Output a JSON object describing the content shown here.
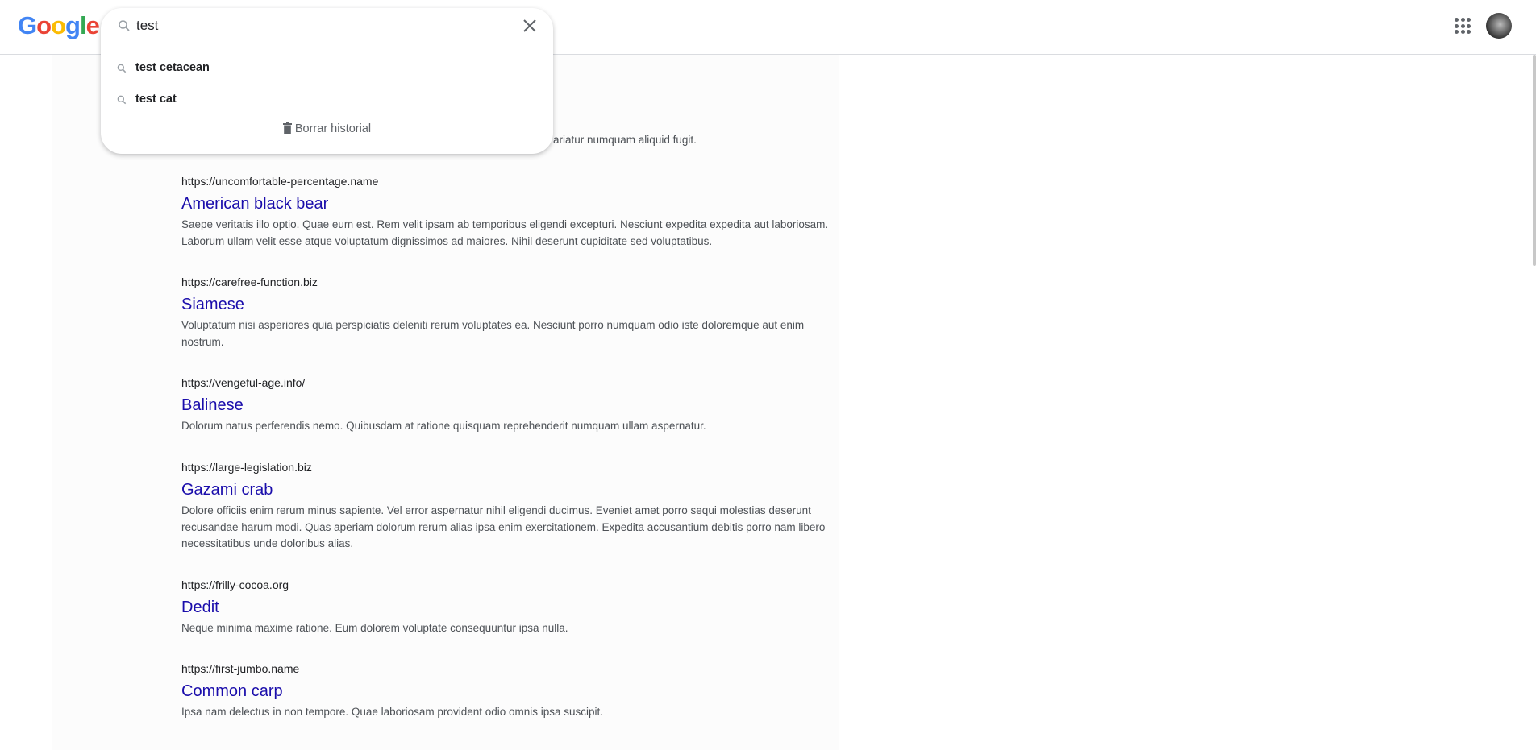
{
  "header": {
    "logo": "Google",
    "logo_colors": [
      "#4285f4",
      "#ea4335",
      "#fbbc05",
      "#4285f4",
      "#34a853",
      "#ea4335"
    ],
    "apps_icon": "grid-icon",
    "avatar": "user-avatar"
  },
  "search": {
    "value": "test",
    "suggestions": [
      {
        "label": "test cetacean"
      },
      {
        "label": "test cat"
      }
    ],
    "clear_history": "Borrar historial"
  },
  "hidden_fragment": "ariatur numquam aliquid fugit.",
  "results": [
    {
      "url": "https://uncomfortable-percentage.name",
      "title": "American black bear",
      "snippet": "Saepe veritatis illo optio. Quae eum est. Rem velit ipsam ab temporibus eligendi excepturi. Nesciunt expedita expedita aut laboriosam. Laborum ullam velit esse atque voluptatum dignissimos ad maiores. Nihil deserunt cupiditate sed voluptatibus."
    },
    {
      "url": "https://carefree-function.biz",
      "title": "Siamese",
      "snippet": "Voluptatum nisi asperiores quia perspiciatis deleniti rerum voluptates ea. Nesciunt porro numquam odio iste doloremque aut enim nostrum."
    },
    {
      "url": "https://vengeful-age.info/",
      "title": "Balinese",
      "snippet": "Dolorum natus perferendis nemo. Quibusdam at ratione quisquam reprehenderit numquam ullam aspernatur."
    },
    {
      "url": "https://large-legislation.biz",
      "title": "Gazami crab",
      "snippet": "Dolore officiis enim rerum minus sapiente. Vel error aspernatur nihil eligendi ducimus. Eveniet amet porro sequi molestias deserunt recusandae harum modi. Quas aperiam dolorum rerum alias ipsa enim exercitationem. Expedita accusantium debitis porro nam libero necessitatibus unde doloribus alias."
    },
    {
      "url": "https://frilly-cocoa.org",
      "title": "Dedit",
      "snippet": "Neque minima maxime ratione. Eum dolorem voluptate consequuntur ipsa nulla."
    },
    {
      "url": "https://first-jumbo.name",
      "title": "Common carp",
      "snippet": "Ipsa nam delectus in non tempore. Quae laboriosam provident odio omnis ipsa suscipit."
    }
  ]
}
